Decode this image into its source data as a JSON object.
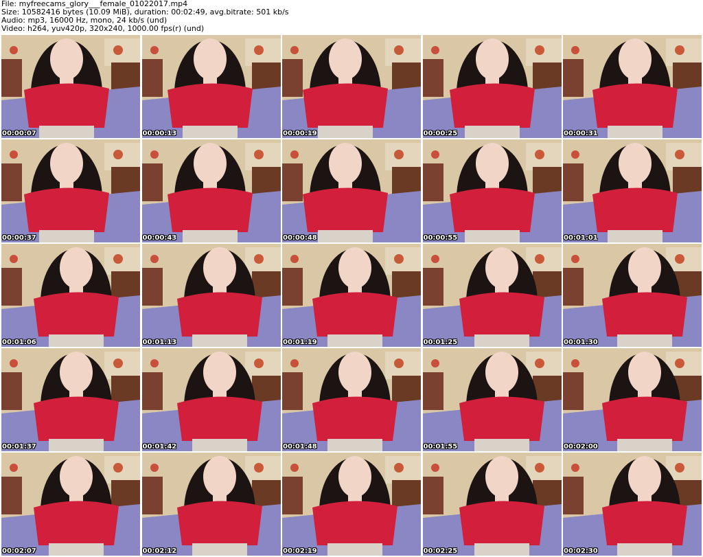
{
  "header": {
    "file": "File: myfreecams_glory___female_01022017.mp4",
    "size": "Size: 10582416 bytes (10.09 MiB), duration: 00:02:49, avg.bitrate: 501 kb/s",
    "audio": "Audio: mp3, 16000 Hz, mono, 24 kb/s (und)",
    "video": "Video: h264, yuv420p, 320x240, 1000.00 fps(r) (und)"
  },
  "thumbnails": [
    {
      "time": "00:00:07"
    },
    {
      "time": "00:00:13"
    },
    {
      "time": "00:00:19"
    },
    {
      "time": "00:00:25"
    },
    {
      "time": "00:00:31"
    },
    {
      "time": "00:00:37"
    },
    {
      "time": "00:00:43"
    },
    {
      "time": "00:00:48"
    },
    {
      "time": "00:00:55"
    },
    {
      "time": "00:01:01"
    },
    {
      "time": "00:01:06"
    },
    {
      "time": "00:01:13"
    },
    {
      "time": "00:01:19"
    },
    {
      "time": "00:01:25"
    },
    {
      "time": "00:01:30"
    },
    {
      "time": "00:01:37"
    },
    {
      "time": "00:01:42"
    },
    {
      "time": "00:01:48"
    },
    {
      "time": "00:01:55"
    },
    {
      "time": "00:02:00"
    },
    {
      "time": "00:02:07"
    },
    {
      "time": "00:02:12"
    },
    {
      "time": "00:02:19"
    },
    {
      "time": "00:02:25"
    },
    {
      "time": "00:02:30"
    }
  ],
  "colors": {
    "wall": "#d9c7a6",
    "bed": "#8b87c4",
    "shirt": "#d21f3c",
    "hair": "#1c1412",
    "skin": "#f1d6c8"
  }
}
